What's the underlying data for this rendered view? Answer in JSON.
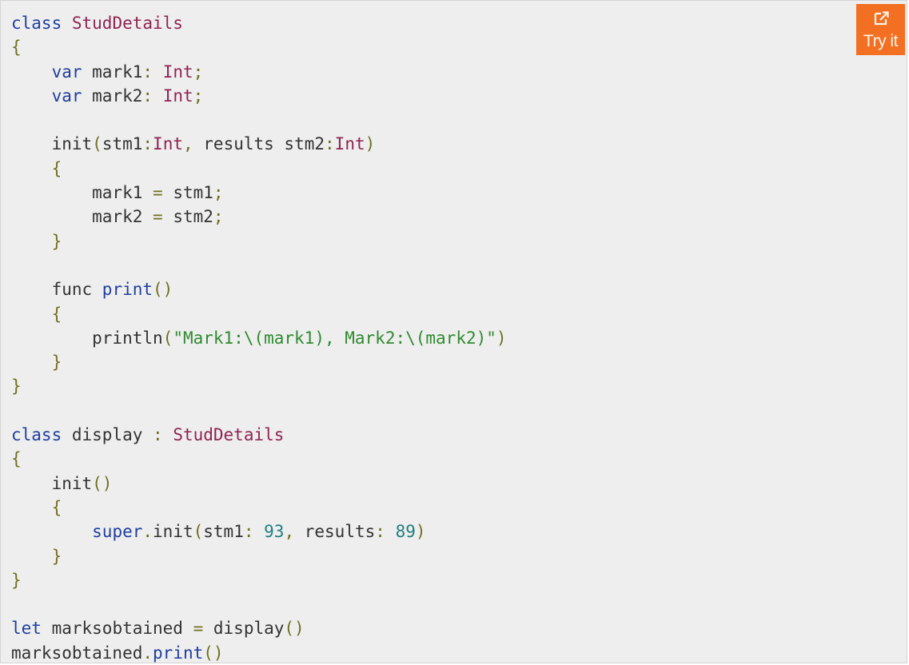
{
  "try_it": {
    "label": "Try it",
    "icon": "external-link-icon",
    "color": "#f36f21"
  },
  "colors": {
    "background": "#eeeeee",
    "keyword": "#1f3f9f",
    "type": "#8f2452",
    "string": "#2e8b2e",
    "number": "#1f7f7f",
    "punctuation": "#707020",
    "plain": "#333333"
  },
  "code": {
    "lines": [
      [
        {
          "t": "class",
          "k": "kw"
        },
        {
          "t": " ",
          "k": "pl"
        },
        {
          "t": "StudDetails",
          "k": "typ"
        }
      ],
      [
        {
          "t": "{",
          "k": "pun"
        }
      ],
      [
        {
          "t": "    ",
          "k": "pl"
        },
        {
          "t": "var",
          "k": "kw"
        },
        {
          "t": " mark1",
          "k": "pl"
        },
        {
          "t": ":",
          "k": "pun"
        },
        {
          "t": " ",
          "k": "pl"
        },
        {
          "t": "Int",
          "k": "typ"
        },
        {
          "t": ";",
          "k": "pun"
        }
      ],
      [
        {
          "t": "    ",
          "k": "pl"
        },
        {
          "t": "var",
          "k": "kw"
        },
        {
          "t": " mark2",
          "k": "pl"
        },
        {
          "t": ":",
          "k": "pun"
        },
        {
          "t": " ",
          "k": "pl"
        },
        {
          "t": "Int",
          "k": "typ"
        },
        {
          "t": ";",
          "k": "pun"
        }
      ],
      [],
      [
        {
          "t": "    init",
          "k": "pl"
        },
        {
          "t": "(",
          "k": "pun"
        },
        {
          "t": "stm1",
          "k": "pl"
        },
        {
          "t": ":",
          "k": "pun"
        },
        {
          "t": "Int",
          "k": "typ"
        },
        {
          "t": ",",
          "k": "pun"
        },
        {
          "t": " results stm2",
          "k": "pl"
        },
        {
          "t": ":",
          "k": "pun"
        },
        {
          "t": "Int",
          "k": "typ"
        },
        {
          "t": ")",
          "k": "pun"
        }
      ],
      [
        {
          "t": "    ",
          "k": "pl"
        },
        {
          "t": "{",
          "k": "pun"
        }
      ],
      [
        {
          "t": "        mark1 ",
          "k": "pl"
        },
        {
          "t": "=",
          "k": "pun"
        },
        {
          "t": " stm1",
          "k": "pl"
        },
        {
          "t": ";",
          "k": "pun"
        }
      ],
      [
        {
          "t": "        mark2 ",
          "k": "pl"
        },
        {
          "t": "=",
          "k": "pun"
        },
        {
          "t": " stm2",
          "k": "pl"
        },
        {
          "t": ";",
          "k": "pun"
        }
      ],
      [
        {
          "t": "    ",
          "k": "pl"
        },
        {
          "t": "}",
          "k": "pun"
        }
      ],
      [],
      [
        {
          "t": "    func ",
          "k": "pl"
        },
        {
          "t": "print",
          "k": "fn"
        },
        {
          "t": "()",
          "k": "pun"
        }
      ],
      [
        {
          "t": "    ",
          "k": "pl"
        },
        {
          "t": "{",
          "k": "pun"
        }
      ],
      [
        {
          "t": "        println",
          "k": "pl"
        },
        {
          "t": "(",
          "k": "pun"
        },
        {
          "t": "\"Mark1:\\(mark1), Mark2:\\(mark2)\"",
          "k": "str"
        },
        {
          "t": ")",
          "k": "pun"
        }
      ],
      [
        {
          "t": "    ",
          "k": "pl"
        },
        {
          "t": "}",
          "k": "pun"
        }
      ],
      [
        {
          "t": "}",
          "k": "pun"
        }
      ],
      [],
      [
        {
          "t": "class",
          "k": "kw"
        },
        {
          "t": " display ",
          "k": "pl"
        },
        {
          "t": ":",
          "k": "pun"
        },
        {
          "t": " ",
          "k": "pl"
        },
        {
          "t": "StudDetails",
          "k": "typ"
        }
      ],
      [
        {
          "t": "{",
          "k": "pun"
        }
      ],
      [
        {
          "t": "    init",
          "k": "pl"
        },
        {
          "t": "()",
          "k": "pun"
        }
      ],
      [
        {
          "t": "    ",
          "k": "pl"
        },
        {
          "t": "{",
          "k": "pun"
        }
      ],
      [
        {
          "t": "        ",
          "k": "pl"
        },
        {
          "t": "super",
          "k": "kw"
        },
        {
          "t": ".",
          "k": "pun"
        },
        {
          "t": "init",
          "k": "pl"
        },
        {
          "t": "(",
          "k": "pun"
        },
        {
          "t": "stm1",
          "k": "pl"
        },
        {
          "t": ":",
          "k": "pun"
        },
        {
          "t": " ",
          "k": "pl"
        },
        {
          "t": "93",
          "k": "num"
        },
        {
          "t": ",",
          "k": "pun"
        },
        {
          "t": " results",
          "k": "pl"
        },
        {
          "t": ":",
          "k": "pun"
        },
        {
          "t": " ",
          "k": "pl"
        },
        {
          "t": "89",
          "k": "num"
        },
        {
          "t": ")",
          "k": "pun"
        }
      ],
      [
        {
          "t": "    ",
          "k": "pl"
        },
        {
          "t": "}",
          "k": "pun"
        }
      ],
      [
        {
          "t": "}",
          "k": "pun"
        }
      ],
      [],
      [
        {
          "t": "let",
          "k": "kw"
        },
        {
          "t": " marksobtained ",
          "k": "pl"
        },
        {
          "t": "=",
          "k": "pun"
        },
        {
          "t": " display",
          "k": "pl"
        },
        {
          "t": "()",
          "k": "pun"
        }
      ],
      [
        {
          "t": "marksobtained",
          "k": "pl"
        },
        {
          "t": ".",
          "k": "pun"
        },
        {
          "t": "print",
          "k": "fn"
        },
        {
          "t": "()",
          "k": "pun"
        }
      ]
    ]
  }
}
